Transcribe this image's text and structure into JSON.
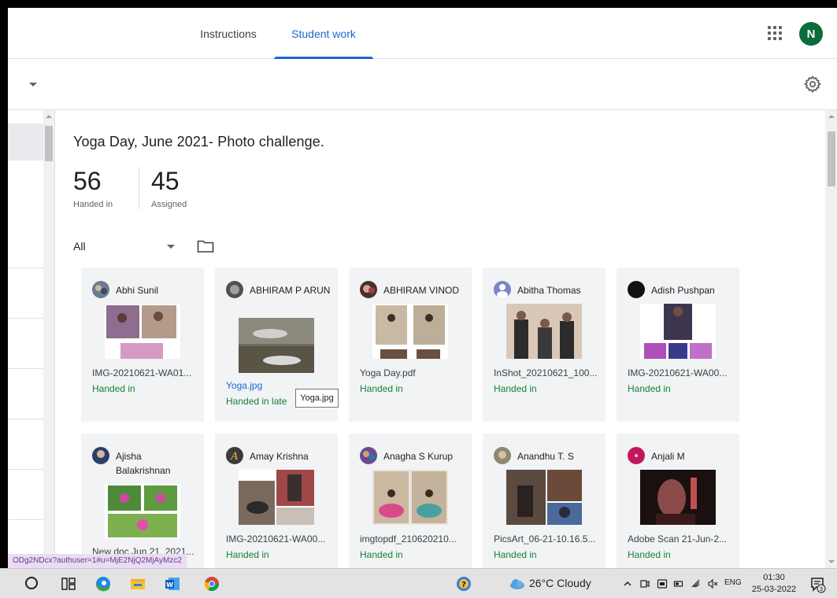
{
  "header": {
    "tabs": [
      {
        "label": "Instructions",
        "active": false
      },
      {
        "label": "Student work",
        "active": true
      }
    ],
    "avatar_initial": "N",
    "accent_color": "#1967d2",
    "avatar_color": "#0b6b3a"
  },
  "assignment": {
    "title": "Yoga Day, June 2021- Photo challenge.",
    "handed_in_count": "56",
    "handed_in_label": "Handed in",
    "assigned_count": "45",
    "assigned_label": "Assigned",
    "filter_value": "All"
  },
  "cards": [
    {
      "name": "Abhi Sunil",
      "file": "IMG-20210621-WA01...",
      "status": "Handed in"
    },
    {
      "name": "ABHIRAM P ARUN",
      "file": "Yoga.jpg",
      "status": "Handed in late"
    },
    {
      "name": "ABHIRAM VINOD",
      "file": "Yoga Day.pdf",
      "status": "Handed in"
    },
    {
      "name": "Abitha Thomas",
      "file": "InShot_20210621_100...",
      "status": "Handed in"
    },
    {
      "name": "Adish Pushpan",
      "file": "IMG-20210621-WA00...",
      "status": "Handed in"
    },
    {
      "name": "Ajisha Balakrishnan",
      "file": "New doc Jun 21, 2021...",
      "status": ""
    },
    {
      "name": "Amay Krishna",
      "file": "IMG-20210621-WA00...",
      "status": "Handed in"
    },
    {
      "name": "Anagha S Kurup",
      "file": "imgtopdf_210620210...",
      "status": "Handed in"
    },
    {
      "name": "Anandhu T. S",
      "file": "PicsArt_06-21-10.16.5...",
      "status": "Handed in"
    },
    {
      "name": "Anjali M",
      "file": "Adobe Scan 21-Jun-2...",
      "status": "Handed in"
    }
  ],
  "tooltip": "Yoga.jpg",
  "status_url": "ODg2NDcx?authuser=1#u=MjE2NjQ2MjAyMzc2",
  "taskbar": {
    "weather": "26°C  Cloudy",
    "lang": "ENG",
    "time": "01:30",
    "date": "25-03-2022",
    "notification_count": "3"
  }
}
